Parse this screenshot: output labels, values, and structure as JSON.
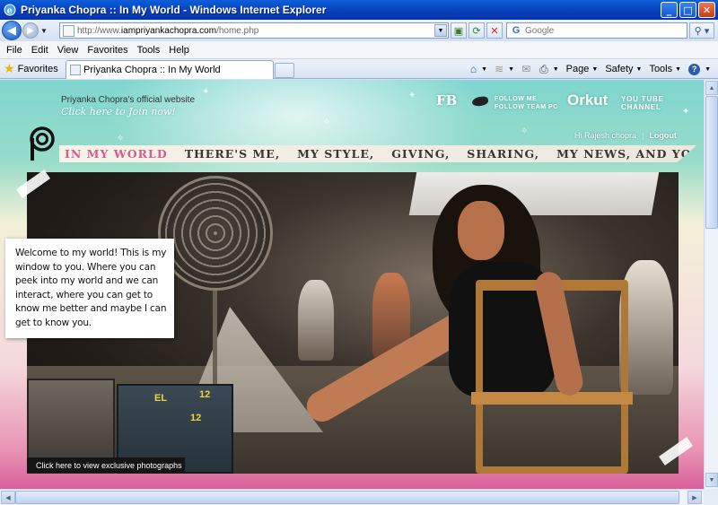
{
  "window": {
    "title": "Priyanka Chopra :: In My World - Windows Internet Explorer",
    "minimize": "_",
    "maximize": "□",
    "close": "✕"
  },
  "address_bar": {
    "url_prefix": "http://www.",
    "url_domain": "iampriyankachopra.com",
    "url_path": "/home.php",
    "search_placeholder": "Google"
  },
  "menu": [
    "File",
    "Edit",
    "View",
    "Favorites",
    "Tools",
    "Help"
  ],
  "tabbar": {
    "favorites_label": "Favorites",
    "tab_title": "Priyanka Chopra :: In My World",
    "commands": [
      {
        "icon": "home-icon",
        "glyph": "⌂",
        "label": ""
      },
      {
        "icon": "feeds-icon",
        "glyph": "≋",
        "label": ""
      },
      {
        "icon": "mail-icon",
        "glyph": "✉",
        "label": ""
      },
      {
        "icon": "print-icon",
        "glyph": "⎙",
        "label": ""
      },
      {
        "icon": "page-icon",
        "glyph": "",
        "label": "Page"
      },
      {
        "icon": "safety-icon",
        "glyph": "",
        "label": "Safety"
      },
      {
        "icon": "tools-icon",
        "glyph": "",
        "label": "Tools"
      },
      {
        "icon": "help-icon",
        "glyph": "?",
        "label": ""
      }
    ]
  },
  "site": {
    "official_text": "Priyanka Chopra's official website",
    "join_text": "Click here to Join now!",
    "social": {
      "fb": "FB",
      "twitter": "FOLLOW ME\nFOLLOW TEAM PC",
      "orkut": "Orkut",
      "youtube": "YOU TUBE\nCHANNEL"
    },
    "user": {
      "greeting": "Hi Rajesh chopra",
      "separator": "|",
      "logout": "Logout"
    },
    "nav": [
      {
        "label": "IN MY WORLD",
        "active": true
      },
      {
        "label": "THERE'S ME,",
        "active": false
      },
      {
        "label": "MY STYLE,",
        "active": false
      },
      {
        "label": "GIVING,",
        "active": false
      },
      {
        "label": "SHARING,",
        "active": false
      },
      {
        "label": "MY NEWS, AND YOU",
        "active": false
      }
    ],
    "welcome_text": "Welcome to my world! This is my window to you. Where you can peek into my world and we can interact, where you can get to know me better and maybe I can get to know you.",
    "photos_link": "Click here to view exclusive photographs",
    "equipment_labels": [
      "EL",
      "12",
      "12"
    ]
  },
  "colors": {
    "accent_pink": "#d35d8d",
    "nav_text": "#3a3530",
    "titlebar_blue": "#0a4bd0"
  }
}
